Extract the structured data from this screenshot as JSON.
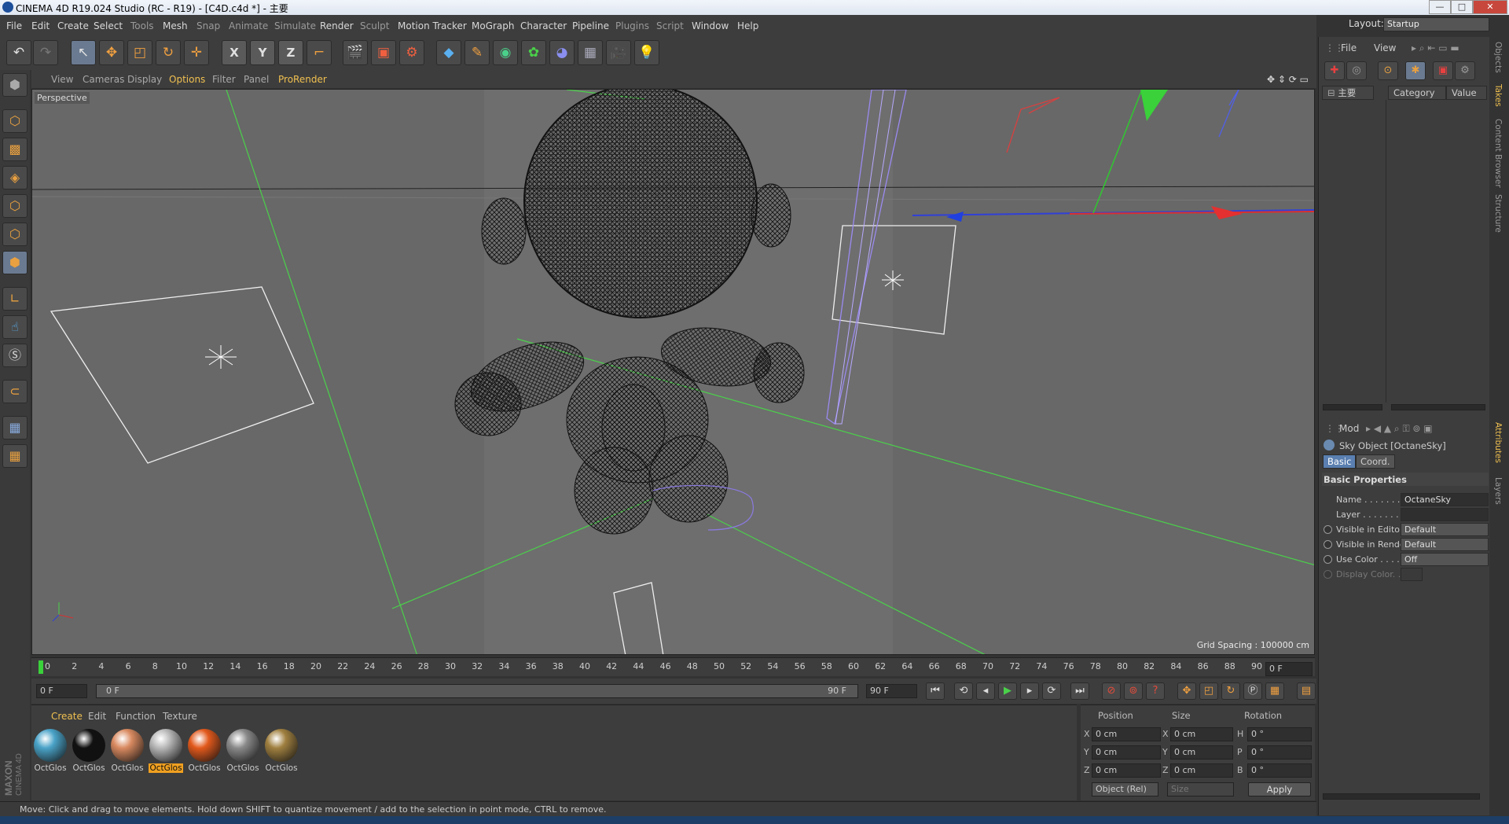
{
  "window": {
    "title": "CINEMA 4D R19.024 Studio (RC - R19) - [C4D.c4d *] - 主要",
    "minimize": "—",
    "maximize": "□",
    "close": "✕"
  },
  "menubar": {
    "items": [
      "File",
      "Edit",
      "Create",
      "Select",
      "Tools",
      "Mesh",
      "Snap",
      "Animate",
      "Simulate",
      "Render",
      "Sculpt",
      "Motion Tracker",
      "MoGraph",
      "Character",
      "Pipeline",
      "Plugins",
      "Script",
      "Window",
      "Help"
    ],
    "layout_label": "Layout:",
    "layout_value": "Startup"
  },
  "viewport": {
    "menu": [
      "View",
      "Cameras",
      "Display",
      "Options",
      "Filter",
      "Panel",
      "ProRender"
    ],
    "active_menu": "Options",
    "camera_label": "Perspective",
    "grid_spacing": "Grid Spacing : 100000 cm"
  },
  "timeline": {
    "ticks": [
      "0",
      "2",
      "4",
      "6",
      "8",
      "10",
      "12",
      "14",
      "16",
      "18",
      "20",
      "22",
      "24",
      "26",
      "28",
      "30",
      "32",
      "34",
      "36",
      "38",
      "40",
      "42",
      "44",
      "46",
      "48",
      "50",
      "52",
      "54",
      "56",
      "58",
      "60",
      "62",
      "64",
      "66",
      "68",
      "70",
      "72",
      "74",
      "76",
      "78",
      "80",
      "82",
      "84",
      "86",
      "88",
      "90"
    ],
    "current_frame": "0 F",
    "start_frame": "0 F",
    "range_start": "0 F",
    "range_end": "90 F",
    "end_frame": "90 F"
  },
  "materials": {
    "menu": [
      "Create",
      "Edit",
      "Function",
      "Texture"
    ],
    "active_menu": "Create",
    "items": [
      {
        "label": "OctGlos",
        "color": "#4aa3c8"
      },
      {
        "label": "OctGlos",
        "color": "#111111"
      },
      {
        "label": "OctGlos",
        "color": "#d98a60"
      },
      {
        "label": "OctGlos",
        "color": "#b8b8b8"
      },
      {
        "label": "OctGlos",
        "color": "#e2591c"
      },
      {
        "label": "OctGlos",
        "color": "#8a8a8a"
      },
      {
        "label": "OctGlos",
        "color": "#a08040"
      }
    ],
    "selected_index": 3
  },
  "coords": {
    "headers": [
      "Position",
      "Size",
      "Rotation"
    ],
    "axes_pos": [
      "X",
      "Y",
      "Z"
    ],
    "axes_rot": [
      "H",
      "P",
      "B"
    ],
    "position": [
      "0 cm",
      "0 cm",
      "0 cm"
    ],
    "size": [
      "0 cm",
      "0 cm",
      "0 cm"
    ],
    "rotation": [
      "0 °",
      "0 °",
      "0 °"
    ],
    "mode": "Object (Rel)",
    "size_mode": "Size",
    "apply": "Apply"
  },
  "status": {
    "text": "Move: Click and drag to move elements. Hold down SHIFT to quantize movement / add to the selection in point mode, CTRL to remove."
  },
  "object_manager": {
    "menu": [
      "File",
      "View"
    ],
    "tree_root": "主要",
    "columns": [
      "Category",
      "Value"
    ]
  },
  "attributes": {
    "menu": "Mod",
    "object_title": "Sky Object [OctaneSky]",
    "tabs": [
      "Basic",
      "Coord."
    ],
    "section": "Basic Properties",
    "rows": [
      {
        "label": "Name . . . . . . . . . . .",
        "value": "OctaneSky"
      },
      {
        "label": "Layer . . . . . . . . . .",
        "value": ""
      },
      {
        "label": "Visible in Editor. . .",
        "value": "Default"
      },
      {
        "label": "Visible in Renderer",
        "value": "Default"
      },
      {
        "label": "Use Color . . . . . . .",
        "value": "Off"
      },
      {
        "label": "Display Color. . . .",
        "value": ""
      }
    ]
  },
  "side_tabs": [
    "Objects",
    "Takes",
    "Content Browser",
    "Structure",
    "Attributes",
    "Layers"
  ],
  "brand": {
    "logo_text_1": "MAXON",
    "logo_text_2": "CINEMA 4D"
  }
}
